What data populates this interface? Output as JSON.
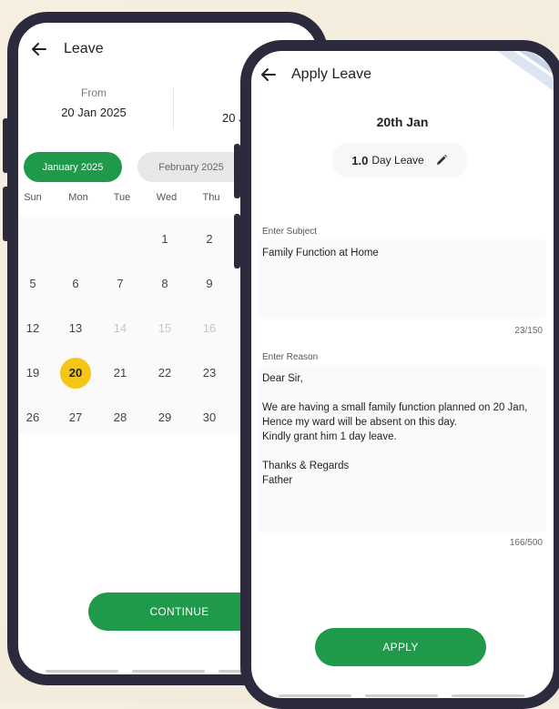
{
  "screen1": {
    "title": "Leave",
    "from_label": "From",
    "from_date": "20 Jan 2025",
    "to_date": "20 J",
    "tabs": [
      "January 2025",
      "February 2025"
    ],
    "weekdays": [
      "Sun",
      "Mon",
      "Tue",
      "Wed",
      "Thu"
    ],
    "days": [
      [
        "",
        "",
        "",
        "1",
        "2"
      ],
      [
        "5",
        "6",
        "7",
        "8",
        "9"
      ],
      [
        "12",
        "13",
        "14",
        "15",
        "16"
      ],
      [
        "19",
        "20",
        "21",
        "22",
        "23"
      ],
      [
        "26",
        "27",
        "28",
        "29",
        "30"
      ]
    ],
    "faded_days": [
      "14",
      "15",
      "16"
    ],
    "selected_day": "20",
    "continue_label": "CONTINUE"
  },
  "screen2": {
    "title": "Apply Leave",
    "date": "20th Jan",
    "leave_count": "1.0",
    "leave_unit": "Day Leave",
    "subject": {
      "label": "Enter Subject",
      "value": "Family Function at Home",
      "counter": "23/150"
    },
    "reason": {
      "label": "Enter Reason",
      "value": "Dear Sir,\n\nWe are having a small family function planned on 20 Jan, Hence my ward will be absent on this day.\nKindly grant him 1 day leave.\n\nThanks & Regards\nFather",
      "counter": "166/500"
    },
    "apply_label": "APPLY"
  },
  "colors": {
    "accent_green": "#1f9a4a",
    "selected_yellow": "#f5c518",
    "frame": "#2c2a3d",
    "background": "#f4ecdc"
  },
  "icons": [
    "back-arrow-icon",
    "pencil-icon"
  ]
}
